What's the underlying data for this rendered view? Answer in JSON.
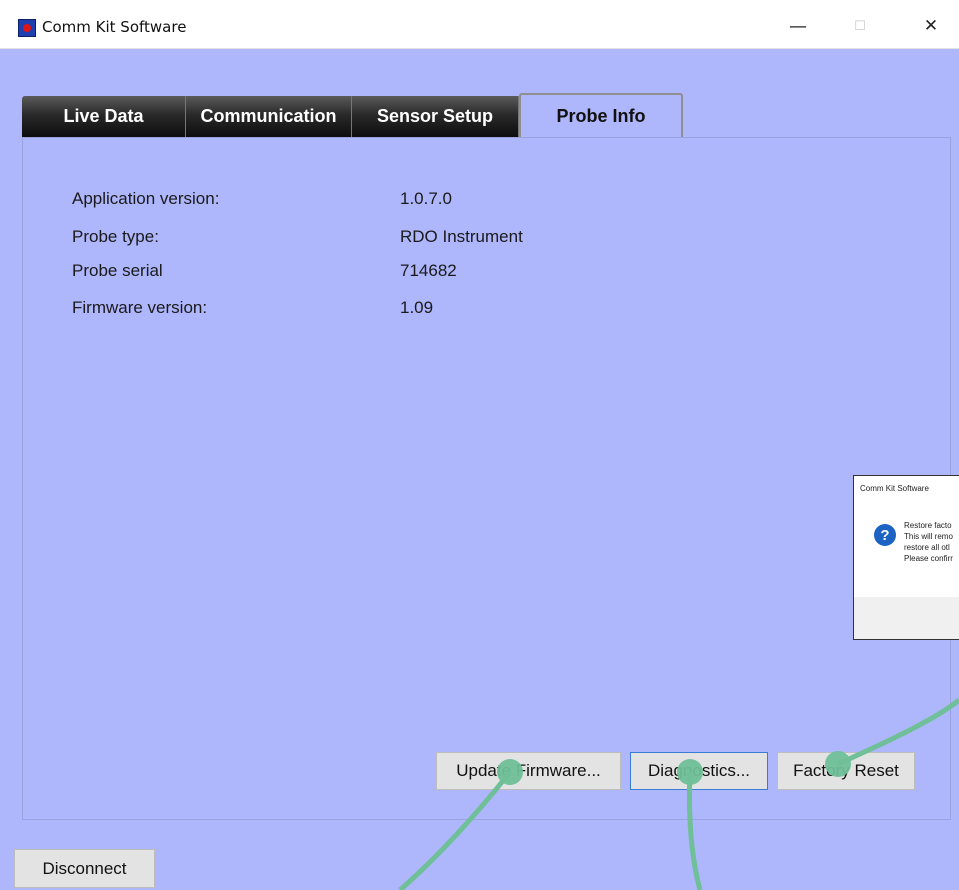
{
  "window": {
    "title": "Comm Kit Software",
    "minimize_glyph": "—",
    "maximize_glyph": "☐",
    "close_glyph": "✕",
    "icon": "app-icon"
  },
  "tabs": [
    {
      "label": "Live Data",
      "selected": false
    },
    {
      "label": "Communication",
      "selected": false
    },
    {
      "label": "Sensor Setup",
      "selected": false
    },
    {
      "label": "Probe Info",
      "selected": true
    }
  ],
  "probe_info": {
    "rows": [
      {
        "label": "Application version:",
        "value": "1.0.7.0"
      },
      {
        "label": "Probe type:",
        "value": "RDO Instrument"
      },
      {
        "label": "Probe serial",
        "value": "714682"
      },
      {
        "label": "Firmware version:",
        "value": "1.09"
      }
    ]
  },
  "buttons": {
    "update_firmware": "Update Firmware...",
    "diagnostics": "Diagnostics...",
    "factory_reset": "Factory Reset",
    "disconnect": "Disconnect"
  },
  "dialog": {
    "title": "Comm Kit Software",
    "icon": "question-icon",
    "icon_glyph": "?",
    "lines": [
      "Restore facto",
      "This will remo",
      "restore all otl",
      "Please confirr"
    ]
  },
  "colors": {
    "background": "#aeb6fc",
    "tab_dark": "#1a1a1a",
    "annotation": "#6fbf98"
  }
}
